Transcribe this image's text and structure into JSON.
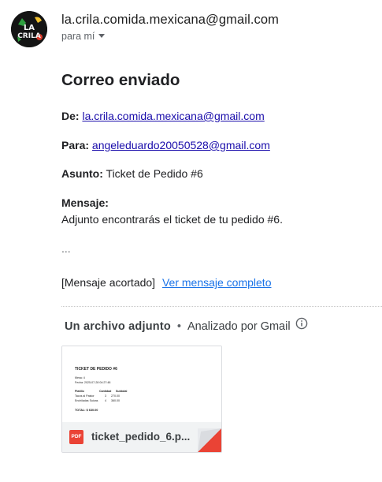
{
  "header": {
    "avatar_text": "LA CRILA",
    "sender_email": "la.crila.comida.mexicana@gmail.com",
    "to_me": "para mí"
  },
  "email": {
    "title": "Correo enviado",
    "from_label": "De:",
    "from_value": "la.crila.comida.mexicana@gmail.com",
    "to_label": "Para:",
    "to_value": "angeleduardo20050528@gmail.com",
    "subject_label": "Asunto:",
    "subject_value": "Ticket de Pedido #6",
    "message_label": "Mensaje:",
    "message_value": "Adjunto encontrarás el ticket de tu pedido #6.",
    "ellipsis": "...",
    "truncated_note": "[Mensaje acortado]",
    "full_message_link": "Ver mensaje completo"
  },
  "attachments": {
    "header": "Un archivo adjunto",
    "separator": "•",
    "scanned": "Analizado por Gmail",
    "file": {
      "type_badge": "PDF",
      "name": "ticket_pedido_6.p...",
      "preview": {
        "heading": "TICKET DE PEDIDO #6",
        "mesa": "Mesa: 4",
        "fecha": "Fecha: 2025-07-28 04:27:48",
        "col_platillo": "Platillo",
        "col_cantidad": "Cantidad",
        "col_subtotal": "Subtotal",
        "row1_name": "Tacos al Pastor",
        "row1_qty": "3",
        "row1_sub": "270.00",
        "row2_name": "Enchiladas Suizas",
        "row2_qty": "4",
        "row2_sub": "360.00",
        "total": "TOTAL: $ 630.00"
      }
    }
  },
  "colors": {
    "link": "#1a0dab",
    "full_link": "#1a73e8",
    "pdf_red": "#ea4335"
  }
}
